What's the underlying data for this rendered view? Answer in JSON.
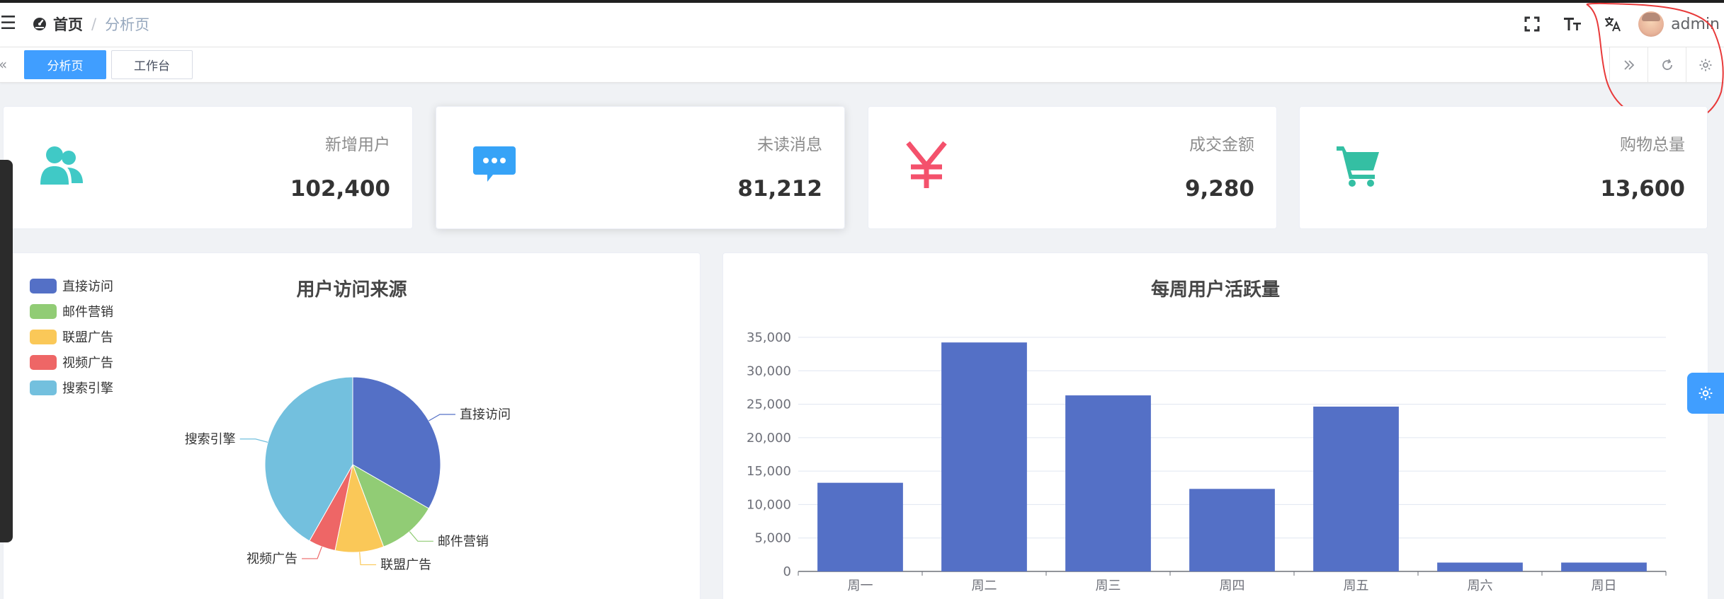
{
  "navbar": {
    "breadcrumb_home": "首页",
    "breadcrumb_separator": "/",
    "breadcrumb_current": "分析页",
    "username": "admin",
    "icons": [
      "hamburger-icon",
      "dashboard-icon",
      "fullscreen-icon",
      "font-size-icon",
      "translate-icon",
      "avatar"
    ]
  },
  "tags": {
    "items": [
      {
        "label": "分析页",
        "active": true
      },
      {
        "label": "工作台",
        "active": false
      }
    ],
    "tools": [
      "double-chevron-right-icon",
      "refresh-icon",
      "gear-icon"
    ]
  },
  "stats": [
    {
      "label": "新增用户",
      "value": "102,400",
      "icon": "users-icon",
      "color": "#40c9c6"
    },
    {
      "label": "未读消息",
      "value": "81,212",
      "icon": "message-icon",
      "color": "#36a3f7"
    },
    {
      "label": "成交金额",
      "value": "9,280",
      "icon": "yen-icon",
      "color": "#f4516c"
    },
    {
      "label": "购物总量",
      "value": "13,600",
      "icon": "cart-icon",
      "color": "#34bfa3"
    }
  ],
  "pie": {
    "title": "用户访问来源",
    "legend": [
      "直接访问",
      "邮件营销",
      "联盟广告",
      "视频广告",
      "搜索引擎"
    ]
  },
  "bar": {
    "title": "每周用户活跃量"
  },
  "chart_data": [
    {
      "type": "pie",
      "title": "用户访问来源",
      "categories": [
        "直接访问",
        "邮件营销",
        "联盟广告",
        "视频广告",
        "搜索引擎"
      ],
      "values": [
        335,
        110,
        90,
        50,
        420
      ],
      "colors": [
        "#5470c6",
        "#91cc75",
        "#fac858",
        "#ee6666",
        "#73c0de"
      ],
      "legend": "top-left"
    },
    {
      "type": "bar",
      "title": "每周用户活跃量",
      "categories": [
        "周一",
        "周二",
        "周三",
        "周四",
        "周五",
        "周六",
        "周日"
      ],
      "values": [
        13253,
        34235,
        26321,
        12340,
        24643,
        1322,
        1324
      ],
      "ylim": [
        0,
        35000
      ],
      "yticks": [
        "0",
        "5,000",
        "10,000",
        "15,000",
        "20,000",
        "25,000",
        "30,000",
        "35,000"
      ],
      "grid": true,
      "color": "#5470c6"
    }
  ]
}
